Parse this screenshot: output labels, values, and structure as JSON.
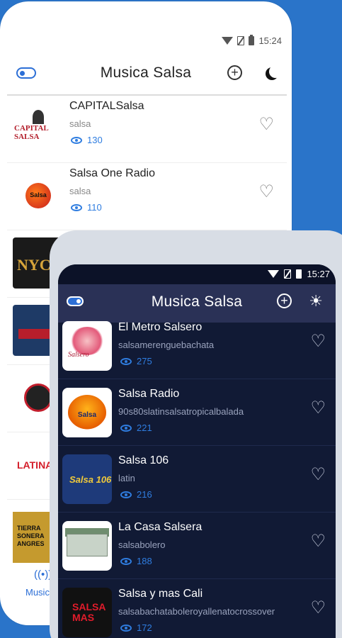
{
  "back_phone": {
    "status": {
      "time": "15:24"
    },
    "header": {
      "title": "Musica Salsa"
    },
    "stations": [
      {
        "name": "CAPITALSalsa",
        "genre": "salsa",
        "views": "130",
        "art": "capital"
      },
      {
        "name": "Salsa One Radio",
        "genre": "salsa",
        "views": "110",
        "art": "salsaone"
      },
      {
        "name": "N",
        "genre": "",
        "views": "",
        "art": "nyc"
      },
      {
        "name": "",
        "genre": "",
        "views": "",
        "art": "city"
      },
      {
        "name": "",
        "genre": "",
        "views": "",
        "art": "person"
      },
      {
        "name": "",
        "genre": "",
        "views": "",
        "art": "latin"
      },
      {
        "name": "",
        "genre": "",
        "views": "",
        "art": "tierra"
      }
    ],
    "bottom_nav": {
      "label": "Music",
      "icon": "radio-icon"
    }
  },
  "front_phone": {
    "status": {
      "time": "15:27"
    },
    "header": {
      "title": "Musica Salsa"
    },
    "stations": [
      {
        "name": "El Metro Salsero",
        "genre": "salsamerenguebachata",
        "views": "275",
        "art": "metro"
      },
      {
        "name": "Salsa Radio",
        "genre": "90s80slatinsalsatropicalbalada",
        "views": "221",
        "art": "radio"
      },
      {
        "name": "Salsa 106",
        "genre": "latin",
        "views": "216",
        "art": "106"
      },
      {
        "name": "La Casa Salsera",
        "genre": "salsabolero",
        "views": "188",
        "art": "casa"
      },
      {
        "name": "Salsa y mas Cali",
        "genre": "salsabachataboleroyallenatocrossover",
        "views": "172",
        "art": "cali"
      }
    ]
  },
  "thumb_text": {
    "capital": "CAPITAL SALSA",
    "salsaone": "Salsa",
    "nyc": "NYC",
    "latin": "LATINA",
    "tierra": "TIERRA SONERA ANGRES",
    "metro": "Salsero",
    "radio": "Salsa",
    "s106": "Salsa 106",
    "cali": "SALSA MAS"
  },
  "colors": {
    "background": "#2a74c9",
    "accent": "#2c6fd6",
    "dark_bg": "#111a35",
    "dark_header": "#2a3156"
  }
}
